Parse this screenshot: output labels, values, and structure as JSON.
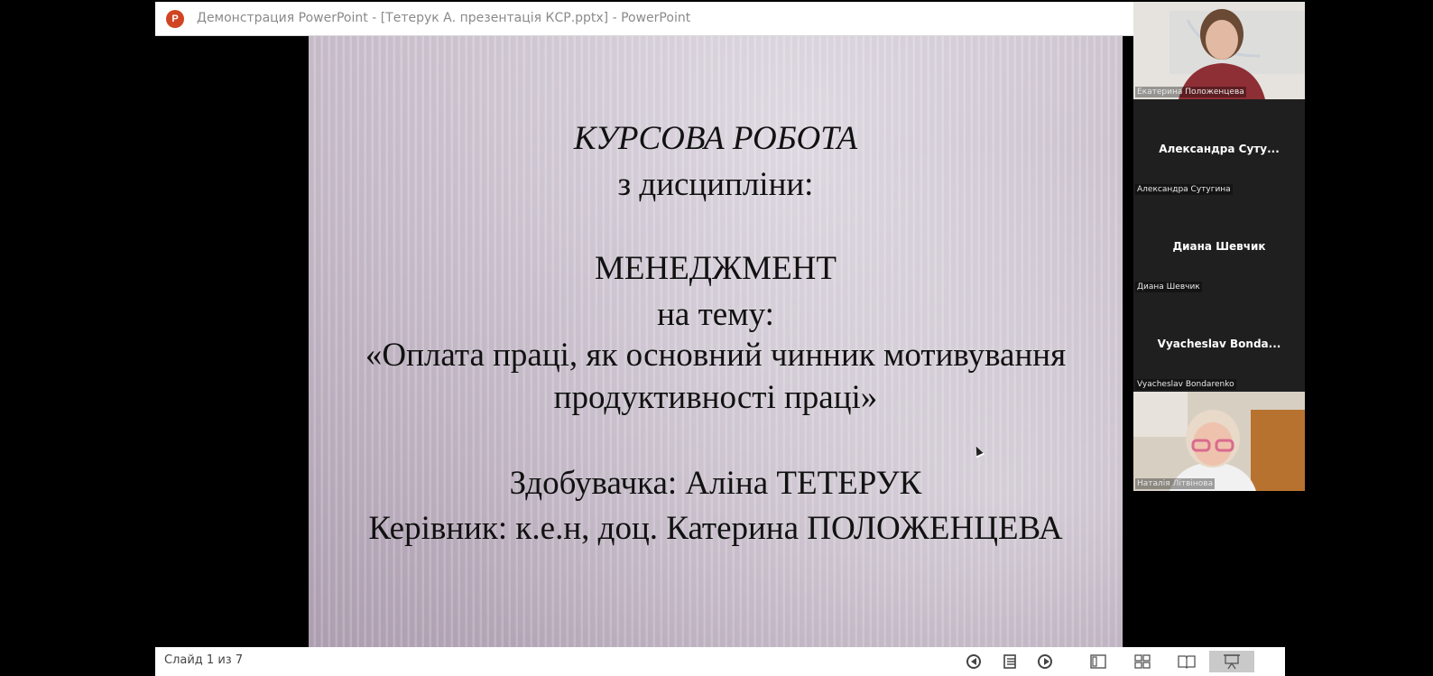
{
  "window": {
    "app_icon": "P",
    "title": "Демонстрация PowerPoint - [Тетерук А. презентація КСР.pptx] - PowerPoint"
  },
  "slide": {
    "line1": "КУРСОВА РОБОТА",
    "line2": "з дисципліни:",
    "line3": "МЕНЕДЖМЕНТ",
    "line4": "на тему:",
    "line5": "«Оплата праці, як основний чинник мотивування",
    "line6": "продуктивності праці»",
    "line7": "Здобувачка: Аліна ТЕТЕРУК",
    "line8": "Керівник: к.е.н, доц. Катерина ПОЛОЖЕНЦЕВА"
  },
  "statusbar": {
    "slide_counter": "Слайд 1 из 7",
    "icons": [
      "previous-icon",
      "slide-list-icon",
      "next-icon",
      "normal-view-icon",
      "slide-sorter-icon",
      "reading-view-icon",
      "slideshow-icon"
    ]
  },
  "participants": [
    {
      "label": "Екатерина Положенцева",
      "has_video": true
    },
    {
      "center_name": "Александра  Суту...",
      "label": "Александра Сутугина",
      "has_video": false
    },
    {
      "center_name": "Диана Шевчик",
      "label": "Диана Шевчик",
      "has_video": false
    },
    {
      "center_name": "Vyacheslav  Bonda...",
      "label": "Vyacheslav Bondarenko",
      "has_video": false
    },
    {
      "label": "Наталія Літвінова",
      "has_video": true
    }
  ]
}
